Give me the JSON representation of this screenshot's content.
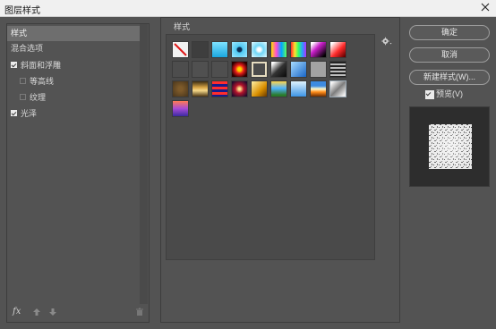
{
  "window": {
    "title": "图层样式"
  },
  "left_panel": {
    "items": [
      {
        "label": "样式",
        "selected": true,
        "checkbox": "none",
        "indent": 0
      },
      {
        "label": "混合选项",
        "selected": false,
        "checkbox": "none",
        "indent": 0
      },
      {
        "label": "斜面和浮雕",
        "selected": false,
        "checkbox": "on",
        "indent": 0
      },
      {
        "label": "等高线",
        "selected": false,
        "checkbox": "off",
        "indent": 1
      },
      {
        "label": "纹理",
        "selected": false,
        "checkbox": "off",
        "indent": 1
      },
      {
        "label": "光泽",
        "selected": false,
        "checkbox": "on",
        "indent": 0
      }
    ],
    "footer": {
      "fx_label": "fx"
    }
  },
  "styles_panel": {
    "label": "样式",
    "swatches": [
      [
        "none",
        "dark-gray",
        "cyan",
        "cyan-dot",
        "cyan-light",
        "color-bars",
        "rainbow",
        "magenta-black",
        "red-white"
      ],
      [
        "gray-1",
        "gray-2",
        "gray-3",
        "red-orb",
        "beige-frame",
        "chrome-dark",
        "blue-glass",
        "gray-4",
        "dark-stripe"
      ],
      [
        "bronze",
        "gold-bar",
        "red-stripes",
        "tiger",
        "gold-glass",
        "sky-stripe",
        "blue-sky",
        "sunset",
        "gray-diamond"
      ],
      [
        "purple-gradient"
      ]
    ],
    "selected_swatch": "gray-diamond"
  },
  "buttons": {
    "ok": "确定",
    "cancel": "取消",
    "new_style": "新建样式(W)..."
  },
  "preview": {
    "label": "预览(V)",
    "checked": true
  },
  "icons": {
    "close": "close-icon",
    "gear": "gear-icon",
    "move_up": "arrow-up-icon",
    "move_down": "arrow-down-icon",
    "trash": "trash-icon"
  }
}
